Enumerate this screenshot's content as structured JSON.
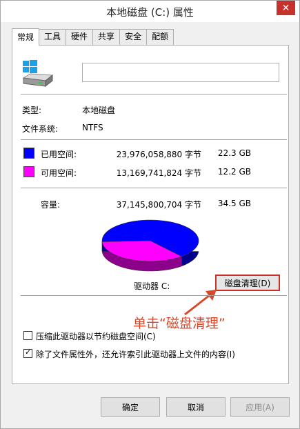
{
  "window": {
    "title": "本地磁盘 (C:) 属性",
    "close_glyph": "✕"
  },
  "tabs": [
    {
      "label": "常规",
      "active": true
    },
    {
      "label": "工具"
    },
    {
      "label": "硬件"
    },
    {
      "label": "共享"
    },
    {
      "label": "安全"
    },
    {
      "label": "配额"
    }
  ],
  "general": {
    "name_value": "",
    "type_label": "类型:",
    "type_value": "本地磁盘",
    "fs_label": "文件系统:",
    "fs_value": "NTFS",
    "used": {
      "label": "已用空间:",
      "bytes": "23,976,058,880 字节",
      "size": "22.3 GB",
      "color": "#0000ff"
    },
    "free": {
      "label": "可用空间:",
      "bytes": "13,169,741,824 字节",
      "size": "12.2 GB",
      "color": "#ff00ff"
    },
    "capacity": {
      "label": "容量:",
      "bytes": "37,145,800,704 字节",
      "size": "34.5 GB"
    },
    "drive_label": "驱动器 C:",
    "clean_button": "磁盘清理(D)",
    "annotation": "单击“磁盘清理”",
    "compress_checkbox": {
      "label": "压缩此驱动器以节约磁盘空间(C)",
      "checked": false
    },
    "index_checkbox": {
      "label": "除了文件属性外，还允许索引此驱动器上文件的内容(I)",
      "checked": true
    }
  },
  "buttons": {
    "ok": "确定",
    "cancel": "取消",
    "apply": "应用(A)"
  },
  "chart_data": {
    "type": "pie",
    "categories": [
      "已用空间",
      "可用空间"
    ],
    "values": [
      23976058880,
      13169741824
    ],
    "colors": [
      "#0000ff",
      "#ff00ff"
    ]
  }
}
